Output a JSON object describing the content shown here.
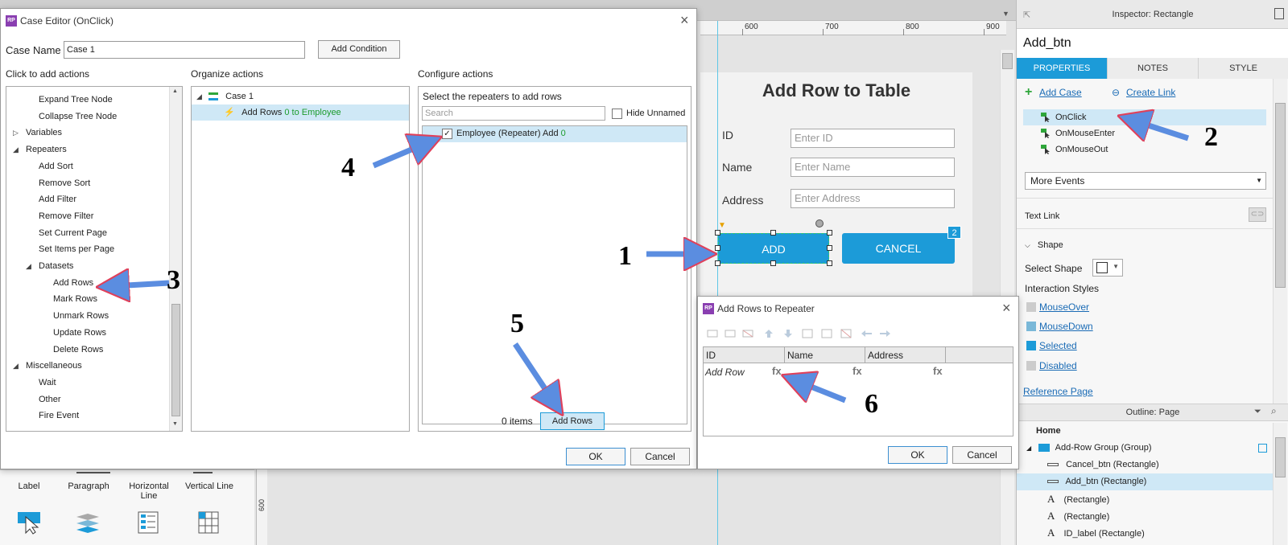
{
  "case_editor": {
    "title": "Case Editor (OnClick)",
    "case_name_label": "Case Name",
    "case_name_value": "Case 1",
    "add_condition": "Add Condition",
    "click_to_add_actions": "Click to add actions",
    "organize_actions": "Organize actions",
    "configure_actions": "Configure actions",
    "actions_tree": [
      {
        "label": "Expand Tree Node",
        "level": 3
      },
      {
        "label": "Collapse Tree Node",
        "level": 3
      },
      {
        "label": "Variables",
        "level": 1,
        "toggle": "collapsed"
      },
      {
        "label": "Repeaters",
        "level": 1,
        "toggle": "expanded"
      },
      {
        "label": "Add Sort",
        "level": 3
      },
      {
        "label": "Remove Sort",
        "level": 3
      },
      {
        "label": "Add Filter",
        "level": 3
      },
      {
        "label": "Remove Filter",
        "level": 3
      },
      {
        "label": "Set Current Page",
        "level": 3
      },
      {
        "label": "Set Items per Page",
        "level": 3
      },
      {
        "label": "Datasets",
        "level": 2,
        "toggle": "expanded"
      },
      {
        "label": "Add Rows",
        "level": 4
      },
      {
        "label": "Mark Rows",
        "level": 4
      },
      {
        "label": "Unmark Rows",
        "level": 4
      },
      {
        "label": "Update Rows",
        "level": 4
      },
      {
        "label": "Delete Rows",
        "level": 4
      },
      {
        "label": "Miscellaneous",
        "level": 1,
        "toggle": "expanded"
      },
      {
        "label": "Wait",
        "level": 3
      },
      {
        "label": "Other",
        "level": 3
      },
      {
        "label": "Fire Event",
        "level": 3
      }
    ],
    "organize": {
      "case_label": "Case 1",
      "action_label": "Add Rows",
      "action_target": "0 to Employee"
    },
    "configure": {
      "prompt": "Select the repeaters to add rows",
      "search_placeholder": "Search",
      "hide_unnamed": "Hide Unnamed",
      "repeater_label": "Employee (Repeater) Add",
      "repeater_count": "0",
      "items_count": "0 items",
      "add_rows_button": "Add Rows"
    },
    "ok": "OK",
    "cancel": "Cancel"
  },
  "add_rows_dialog": {
    "title": "Add Rows to Repeater",
    "columns": [
      "ID",
      "Name",
      "Address"
    ],
    "add_row": "Add Row",
    "fx": "fx",
    "ok": "OK",
    "cancel": "Cancel"
  },
  "design": {
    "ruler_labels": [
      "600",
      "700",
      "800",
      "900"
    ],
    "heading": "Add Row to Table",
    "fields": [
      {
        "label": "ID",
        "placeholder": "Enter ID"
      },
      {
        "label": "Name",
        "placeholder": "Enter Name"
      },
      {
        "label": "Address",
        "placeholder": "Enter Address"
      }
    ],
    "add_button": "ADD",
    "cancel_button": "CANCEL",
    "badge": "2",
    "ruler_v_label": "600"
  },
  "widget_library": {
    "items": [
      "Label",
      "Paragraph",
      "Horizontal Line",
      "Vertical Line"
    ]
  },
  "inspector": {
    "title": "Inspector: Rectangle",
    "widget_name": "Add_btn",
    "tabs": [
      "PROPERTIES",
      "NOTES",
      "STYLE"
    ],
    "add_case": "Add Case",
    "create_link": "Create Link",
    "events": [
      "OnClick",
      "OnMouseEnter",
      "OnMouseOut"
    ],
    "more_events": "More Events",
    "text_link": "Text Link",
    "shape_section": "Shape",
    "select_shape": "Select Shape",
    "interaction_styles": "Interaction Styles",
    "styles": [
      "MouseOver",
      "MouseDown",
      "Selected",
      "Disabled"
    ],
    "reference_page": "Reference Page"
  },
  "outline": {
    "title": "Outline: Page",
    "rows": [
      {
        "label": "Home",
        "indent": 0
      },
      {
        "label": "Add-Row Group (Group)",
        "indent": 1
      },
      {
        "label": "Cancel_btn (Rectangle)",
        "indent": 2
      },
      {
        "label": "Add_btn (Rectangle)",
        "indent": 2
      },
      {
        "label": "(Rectangle)",
        "indent": 2
      },
      {
        "label": "(Rectangle)",
        "indent": 2
      },
      {
        "label": "ID_label (Rectangle)",
        "indent": 2
      }
    ]
  },
  "annotations": [
    "1",
    "2",
    "3",
    "4",
    "5",
    "6"
  ],
  "colors": {
    "accent": "#1c9bd8",
    "selection": "#cfe8f6",
    "arrow": "#5b8de0",
    "green": "#1c9b2c"
  }
}
